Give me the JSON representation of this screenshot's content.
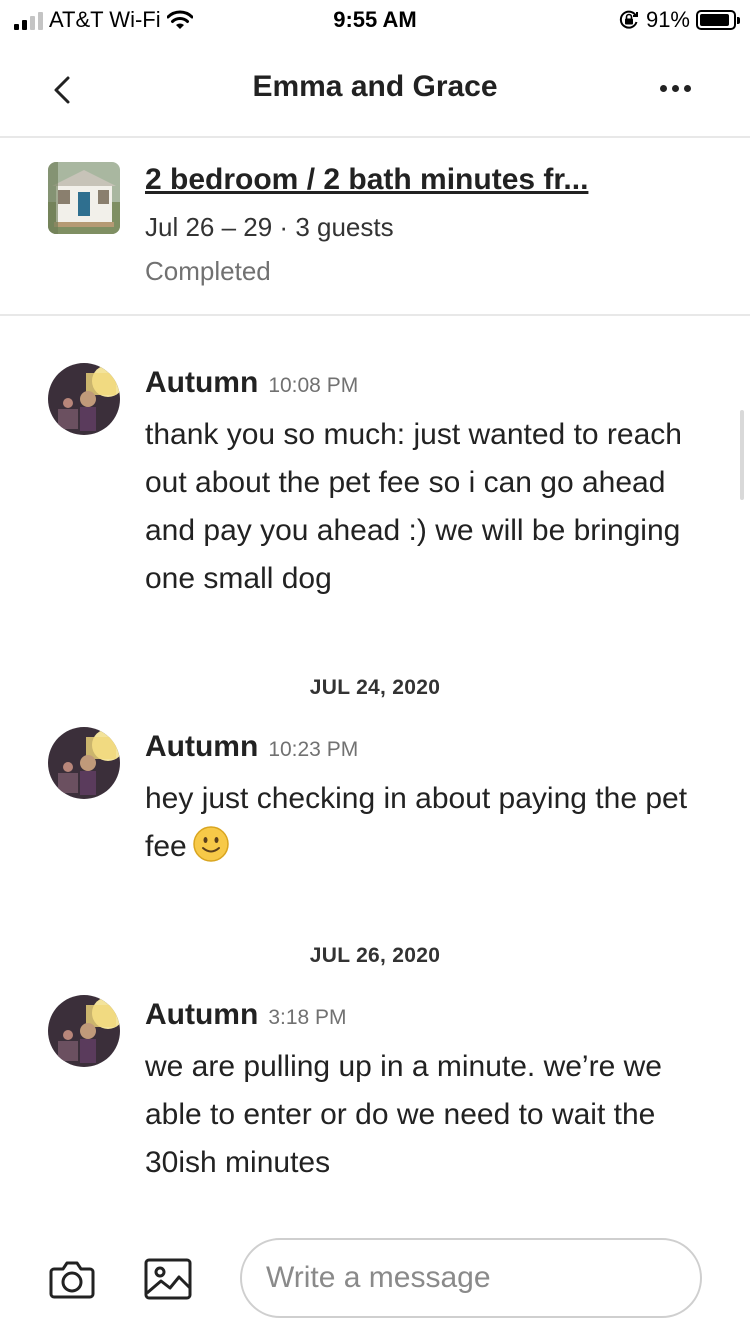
{
  "status_bar": {
    "carrier": "AT&T Wi-Fi",
    "time": "9:55 AM",
    "battery_percent": "91%",
    "battery_level": 0.91,
    "signal_bars": 2
  },
  "header": {
    "title": "Emma and Grace",
    "back_icon": "chevron-left-icon",
    "more_icon": "more-horizontal-icon"
  },
  "listing": {
    "title": "2 bedroom / 2 bath minutes fr...",
    "dates": "Jul 26 – 29 · 3 guests",
    "status": "Completed"
  },
  "messages": [
    {
      "sender": "Autumn",
      "time": "10:08 PM",
      "text": "thank you so much: just wanted to reach out about the pet fee so i can go ahead and pay you ahead :) we will be bringing one small dog"
    },
    {
      "date_separator": "JUL 24, 2020",
      "sender": "Autumn",
      "time": "10:23 PM",
      "text": "hey just checking in about paying the pet fee",
      "emoji": "slightly-smiling-face"
    },
    {
      "date_separator": "JUL 26, 2020",
      "sender": "Autumn",
      "time": "3:18 PM",
      "text": "we are pulling up in a minute. we’re we able to enter or do we need to wait the 30ish minutes"
    }
  ],
  "composer": {
    "placeholder": "Write a message",
    "camera_icon": "camera-icon",
    "gallery_icon": "image-icon"
  },
  "colors": {
    "text_primary": "#222222",
    "text_secondary": "#717171",
    "divider": "#e8e8e8",
    "input_border": "#cfcfcf",
    "emoji_yellow": "#f7c948"
  }
}
